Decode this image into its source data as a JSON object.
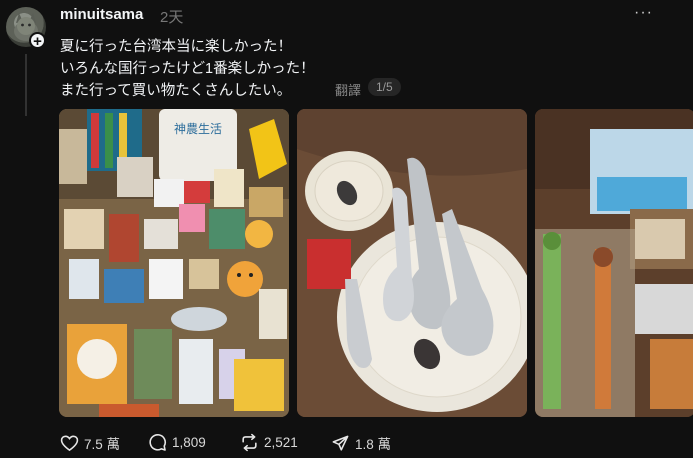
{
  "post": {
    "username": "minuitsama",
    "time": "2天",
    "more": "···",
    "lines": [
      "夏に行った台湾本当に楽しかった！",
      "いろんな国行ったけど1番楽しかった！",
      "また行って買い物たくさんしたい。"
    ],
    "translate_label": "翻譯",
    "image_counter": "1/5"
  },
  "media": [
    {
      "desc": "photo of Taiwan souvenirs",
      "tote_text": "神農生活"
    },
    {
      "desc": "photo of spoons and dishes"
    },
    {
      "desc": "photo of pens and gift boxes"
    }
  ],
  "actions": {
    "like_count": "7.5 萬",
    "comment_count": "1,809",
    "repost_count": "2,521",
    "share_count": "1.8 萬"
  },
  "colors": {
    "background": "#101010",
    "text": "#f3f5f7",
    "muted": "#777777"
  }
}
